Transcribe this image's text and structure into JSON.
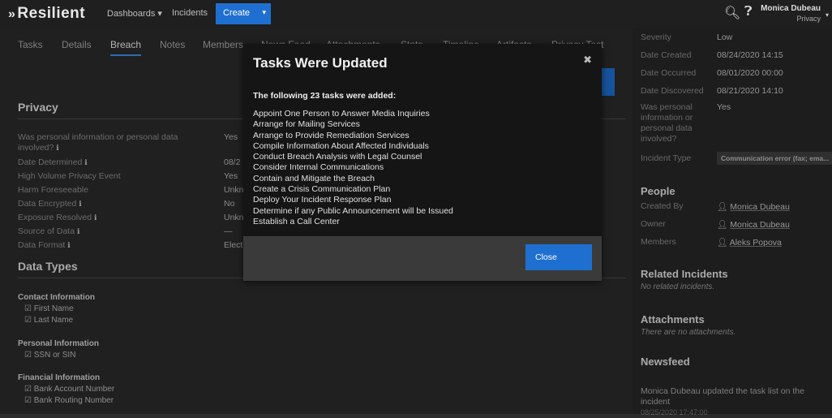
{
  "topbar": {
    "logo": "Resilient",
    "nav": [
      "Dashboards ▾",
      "Incidents"
    ],
    "create": "Create",
    "user_name": "Monica Dubeau",
    "user_org": "Privacy"
  },
  "tabs": [
    "Tasks",
    "Details",
    "Breach",
    "Notes",
    "Members",
    "News Feed",
    "Attachments",
    "Stats",
    "Timeline",
    "Artifacts",
    "Privacy Test"
  ],
  "privacy": {
    "heading": "Privacy",
    "fields": [
      {
        "label": "Was personal information or personal data involved?",
        "value": "Yes"
      },
      {
        "label": "Date Determined",
        "value": "08/2"
      },
      {
        "label": "High Volume Privacy Event",
        "value": "Yes"
      },
      {
        "label": "Harm Foreseeable",
        "value": "Unkn"
      },
      {
        "label": "Data Encrypted",
        "value": "No"
      },
      {
        "label": "Exposure Resolved",
        "value": "Unkn"
      },
      {
        "label": "Source of Data",
        "value": "—"
      },
      {
        "label": "Data Format",
        "value": "Elect"
      }
    ]
  },
  "data_types": {
    "heading": "Data Types",
    "groups": [
      {
        "name": "Contact Information",
        "items": [
          "First Name",
          "Last Name"
        ]
      },
      {
        "name": "Personal Information",
        "items": [
          "SSN or SIN"
        ]
      },
      {
        "name": "Financial Information",
        "items": [
          "Bank Account Number",
          "Bank Routing Number"
        ]
      }
    ]
  },
  "details": {
    "severity_label": "Severity",
    "severity": "Low",
    "created_label": "Date Created",
    "created": "08/24/2020 14:15",
    "occurred_label": "Date Occurred",
    "occurred": "08/01/2020 00:00",
    "discovered_label": "Date Discovered",
    "discovered": "08/21/2020 14:10",
    "personal_label": "Was personal information or personal data involved?",
    "personal": "Yes",
    "type_label": "Incident Type",
    "type": "Communication error (fax; ema..."
  },
  "people": {
    "heading": "People",
    "created_by_label": "Created By",
    "created_by": "Monica Dubeau",
    "owner_label": "Owner",
    "owner": "Monica Dubeau",
    "members_label": "Members",
    "members": "Aleks Popova"
  },
  "related": {
    "heading": "Related Incidents",
    "text": "No related incidents."
  },
  "attachments": {
    "heading": "Attachments",
    "text": "There are no attachments."
  },
  "newsfeed": {
    "heading": "Newsfeed",
    "entry": "Monica Dubeau updated the task list on the incident",
    "time": "08/25/2020 17:47:00"
  },
  "modal": {
    "title": "Tasks Were Updated",
    "lead": "The following 23 tasks were added:",
    "tasks": [
      "Appoint One Person to Answer Media Inquiries",
      "Arrange for Mailing Services",
      "Arrange to Provide Remediation Services",
      "Compile Information About Affected Individuals",
      "Conduct Breach Analysis with Legal Counsel",
      "Consider Internal Communications",
      "Contain and Mitigate the Breach",
      "Create a Crisis Communication Plan",
      "Deploy Your Incident Response Plan",
      "Determine if any Public Announcement will be Issued",
      "Establish a Call Center"
    ],
    "close": "Close"
  }
}
